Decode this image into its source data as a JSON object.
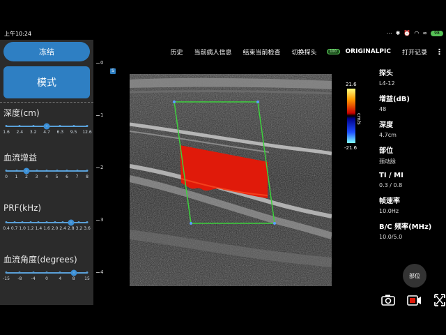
{
  "status": {
    "time": "上午10:24",
    "battery": "98"
  },
  "left_panel": {
    "freeze_label": "冻结",
    "mode_label": "模式",
    "params": [
      {
        "label": "深度(cm)",
        "ticks": [
          "1.6",
          "2.4",
          "3.2",
          "4.7",
          "6.3",
          "9.5",
          "12.6"
        ],
        "selected_index": 3
      },
      {
        "label": "血流增益",
        "ticks": [
          "0",
          "1",
          "2",
          "3",
          "4",
          "5",
          "6",
          "7",
          "8"
        ],
        "selected_index": 2
      },
      {
        "label": "PRF(kHz)",
        "ticks": [
          "0.4",
          "0.7",
          "1.0",
          "1.2",
          "1.4",
          "1.6",
          "2.0",
          "2.4",
          "2.8",
          "3.2",
          "3.6"
        ],
        "selected_index": 8
      },
      {
        "label": "血流角度(degrees)",
        "ticks": [
          "-15",
          "-8",
          "-4",
          "0",
          "4",
          "8",
          "15"
        ],
        "selected_index": 5
      }
    ],
    "scroll_up_glyph": "▲"
  },
  "toolbar": {
    "history": "历史",
    "current_patient": "当前病人信息",
    "end_exam": "结束当前检查",
    "switch_probe": "切换探头",
    "pill_text": "100",
    "brand": "ORIGINALPIC",
    "open_records": "打开记录",
    "more": "⋮"
  },
  "depth_scale": {
    "labels": [
      "0",
      "1",
      "2",
      "3",
      "4"
    ],
    "zoom_badge": "S"
  },
  "color_bar": {
    "max": "21.6",
    "min": "-21.6",
    "unit": "cm/s"
  },
  "info": {
    "probe_key": "探头",
    "probe_val": "L4-12",
    "gain_key": "增益(dB)",
    "gain_val": "48",
    "depth_key": "深度",
    "depth_val": "4.7cm",
    "site_key": "部位",
    "site_val": "颈动脉",
    "timi_key": "TI / MI",
    "timi_val": "0.3 / 0.8",
    "frame_key": "帧速率",
    "frame_val": "10.0Hz",
    "bc_key": "B/C 频率(MHz)",
    "bc_val": "10.0/5.0"
  },
  "site_button": "部位",
  "colors": {
    "accent": "#2e7fc3",
    "roi": "#3dd13d",
    "flow": "#e01a0a"
  }
}
